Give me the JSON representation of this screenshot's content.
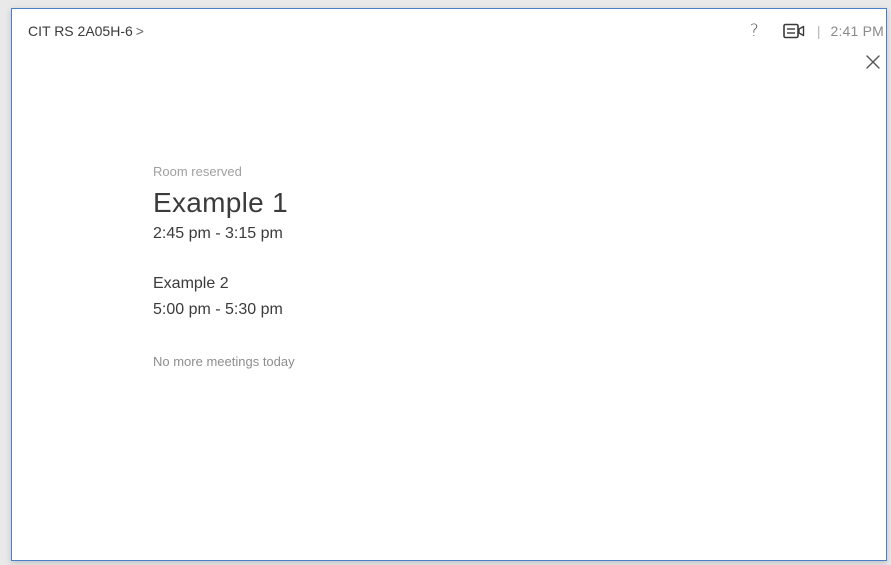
{
  "header": {
    "room_name": "CIT RS 2A05H-6",
    "chevron": ">",
    "help_label": "?",
    "separator": "|",
    "clock": "2:41 PM"
  },
  "icons": {
    "help": "help-icon",
    "camera": "video-camera-icon",
    "close": "close-icon"
  },
  "meetings": {
    "status": "Room reserved",
    "current": {
      "title": "Example 1",
      "time": "2:45 pm - 3:15 pm"
    },
    "next": {
      "title": "Example 2",
      "time": "5:00 pm - 5:30 pm"
    },
    "footer": "No more meetings today"
  },
  "colors": {
    "frame_border": "#4a7fc9",
    "text_primary": "#3b3b3b",
    "text_muted": "#a0a0a0"
  }
}
